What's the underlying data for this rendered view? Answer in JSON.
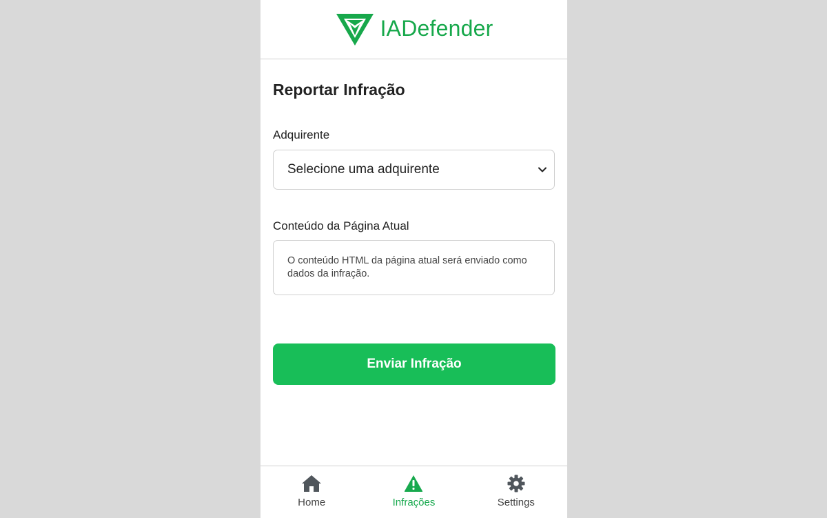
{
  "colors": {
    "brand": "#17a84b",
    "button": "#18be58",
    "active_nav": "#18a94e",
    "background": "#d9d9d9"
  },
  "header": {
    "brand_name": "IADefender",
    "logo_icon": "shield-v-logo-icon"
  },
  "form": {
    "title": "Reportar Infração",
    "acquirer_label": "Adquirente",
    "acquirer_selected": "Selecione uma adquirente",
    "content_label": "Conteúdo da Página Atual",
    "content_text": "O conteúdo HTML da página atual será enviado como dados da infração.",
    "submit_label": "Enviar Infração"
  },
  "nav": {
    "items": [
      {
        "label": "Home",
        "icon": "home-icon",
        "active": false
      },
      {
        "label": "Infrações",
        "icon": "warning-icon",
        "active": true
      },
      {
        "label": "Settings",
        "icon": "gear-icon",
        "active": false
      }
    ]
  }
}
